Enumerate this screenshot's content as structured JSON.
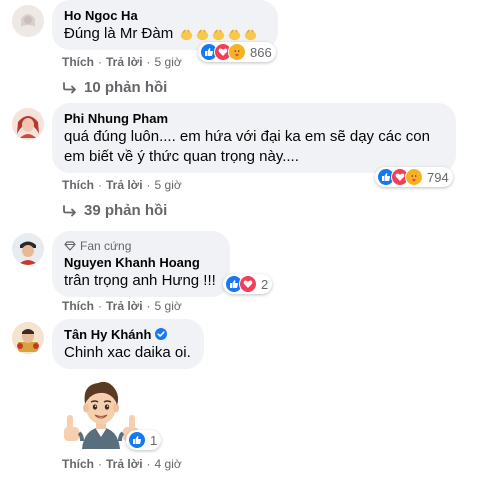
{
  "comments": [
    {
      "author": "Ho Ngoc Ha",
      "text": "Đúng là Mr Đàm",
      "like_label": "Thích",
      "reply_label": "Trả lời",
      "time": "5 giờ",
      "reactions": [
        "like",
        "love",
        "care"
      ],
      "reaction_count": "866",
      "replies_label": "10 phản hồi"
    },
    {
      "author": "Phi Nhung Pham",
      "text_line1": "quá đúng luôn.... em hứa với đại ka em sẽ dạy các con",
      "text_line2": "em biết về ý thức quan trọng này....",
      "like_label": "Thích",
      "reply_label": "Trả lời",
      "time": "5 giờ",
      "reactions": [
        "like",
        "love",
        "care"
      ],
      "reaction_count": "794",
      "replies_label": "39 phản hồi"
    },
    {
      "badge": "Fan cứng",
      "author": "Nguyen Khanh Hoang",
      "text": "trân trọng anh Hưng !!!",
      "like_label": "Thích",
      "reply_label": "Trả lời",
      "time": "5 giờ",
      "reactions": [
        "like",
        "love"
      ],
      "reaction_count": "2"
    },
    {
      "author": "Tân Hy Khánh",
      "verified": true,
      "text": "Chinh xac daika oi.",
      "like_label": "Thích",
      "reply_label": "Trả lời",
      "time": "4 giờ",
      "reactions": [
        "like"
      ],
      "reaction_count": "1"
    }
  ],
  "colors": {
    "like": "#1877f2",
    "love": "#f33e58",
    "care": "#f7b125",
    "bubble": "#f0f2f5",
    "meta": "#65676b"
  }
}
